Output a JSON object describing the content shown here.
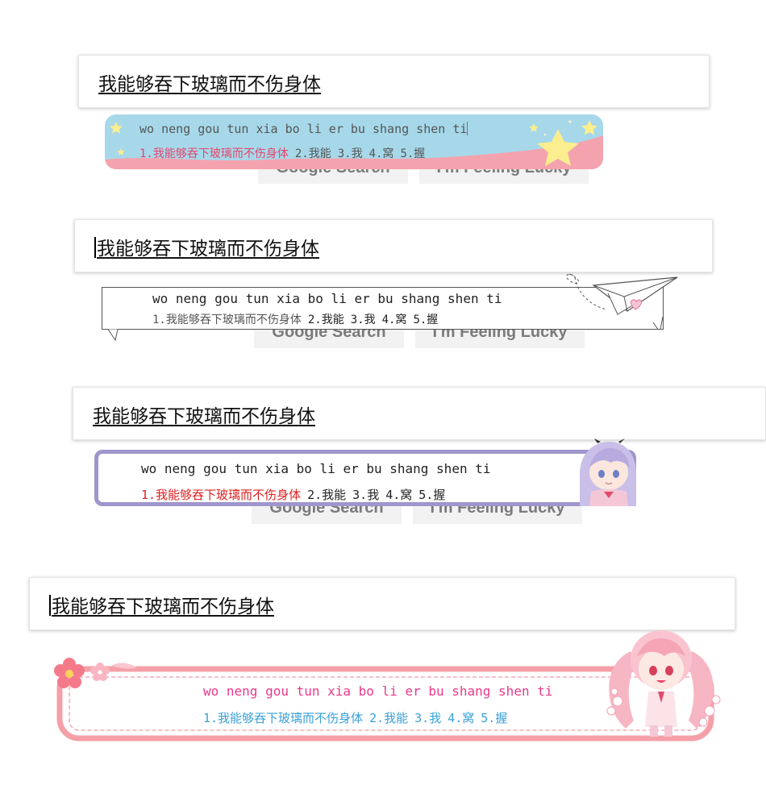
{
  "google_buttons": {
    "search": "Google Search",
    "lucky": "I'm Feeling Lucky"
  },
  "demos": [
    {
      "typed_text": "我能够吞下玻璃而不伤身体",
      "ime": {
        "pinyin": "wo neng gou tun xia bo li er bu shang shen ti",
        "candidates": [
          "1.我能够吞下玻璃而不伤身体",
          "2.我能",
          "3.我",
          "4.窝",
          "5.握"
        ],
        "theme": "starry-sky",
        "colors": {
          "background": "#a6d8ea",
          "wave": "#f4a3ae",
          "highlight": "#e8456b",
          "stars": "#fbee8f"
        }
      }
    },
    {
      "typed_text": "我能够吞下玻璃而不伤身体",
      "ime": {
        "pinyin": "wo neng gou tun xia bo li er bu shang shen ti",
        "candidates": [
          "1.我能够吞下玻璃而不伤身体",
          "2.我能",
          "3.我",
          "4.窝",
          "5.握"
        ],
        "theme": "paper-plane-ribbon",
        "colors": {
          "border": "#555555",
          "heart": "#e8749a"
        }
      }
    },
    {
      "typed_text": "我能够吞下玻璃而不伤身体",
      "ime": {
        "pinyin": "wo neng gou tun xia bo li er bu shang shen ti",
        "candidates": [
          "1.我能够吞下玻璃而不伤身体",
          "2.我能",
          "3.我",
          "4.窝",
          "5.握"
        ],
        "theme": "lavender-frame-anime",
        "colors": {
          "border": "#9e96cc",
          "highlight": "#e02020",
          "hair": "#c9bfe8"
        }
      }
    },
    {
      "typed_text": "我能够吞下玻璃而不伤身体",
      "ime": {
        "pinyin": "wo neng gou tun xia bo li er bu shang shen ti",
        "candidates": [
          "1.我能够吞下玻璃而不伤身体",
          "2.我能",
          "3.我",
          "4.窝",
          "5.握"
        ],
        "theme": "sakura-pink",
        "colors": {
          "border": "#f5a0a8",
          "pinyin": "#e83a8c",
          "candidates": "#3aa0d8",
          "dash": "#f09aa6"
        }
      }
    }
  ]
}
